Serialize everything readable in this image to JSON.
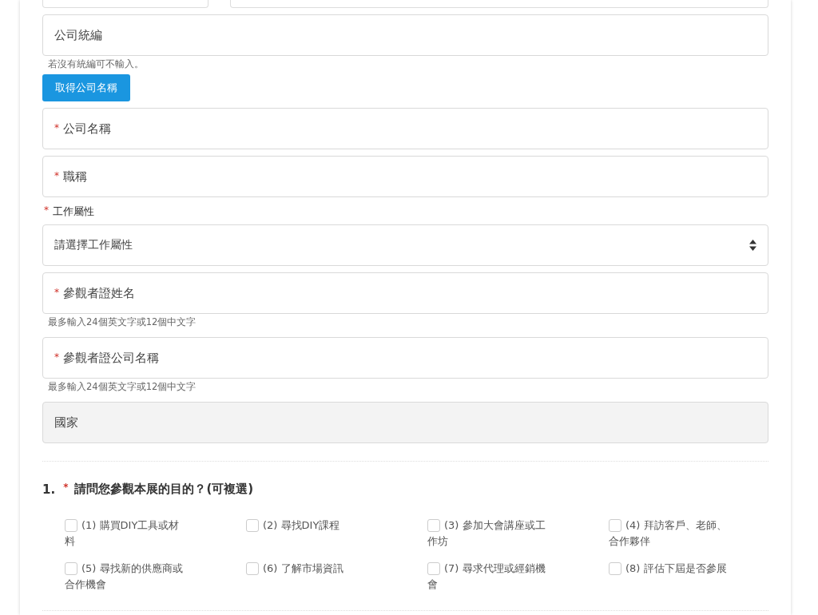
{
  "top_row": [
    {
      "kind": "input"
    },
    {
      "kind": "input"
    }
  ],
  "fields": [
    {
      "kind": "input",
      "placeholder": "公司統編",
      "hint": "若沒有統編可不輸入。",
      "button": "取得公司名稱"
    },
    {
      "kind": "input",
      "placeholder": "公司名稱",
      "required_mark": "*"
    },
    {
      "kind": "input",
      "placeholder": "職稱",
      "required_mark": "*"
    },
    {
      "kind": "select",
      "label": "工作屬性",
      "required_mark": "*",
      "value": "請選擇工作屬性"
    },
    {
      "kind": "input",
      "placeholder": "參觀者證姓名",
      "required_mark": "*",
      "hint": "最多輸入24個英文字或12個中文字"
    },
    {
      "kind": "input",
      "placeholder": "參觀者證公司名稱",
      "required_mark": "*",
      "hint": "最多輸入24個英文字或12個中文字"
    },
    {
      "kind": "input",
      "placeholder": "國家",
      "disabled": true
    }
  ],
  "question": {
    "number": "1.",
    "required_mark": "*",
    "text": "請問您參觀本展的目的？(可複選)",
    "options": [
      {
        "label": "(1) 購買DIY工具或材料",
        "checked": false
      },
      {
        "label": "(2) 尋找DIY課程",
        "checked": false
      },
      {
        "label": "(3) 參加大會講座或工作坊",
        "checked": false
      },
      {
        "label": "(4) 拜訪客戶、老師、合作夥伴",
        "checked": false
      },
      {
        "label": "(5) 尋找新的供應商或合作機會",
        "checked": false
      },
      {
        "label": "(6) 了解市場資訊",
        "checked": false
      },
      {
        "label": "(7) 尋求代理或經銷機會",
        "checked": false
      },
      {
        "label": "(8) 評估下屆是否參展",
        "checked": false
      }
    ]
  }
}
